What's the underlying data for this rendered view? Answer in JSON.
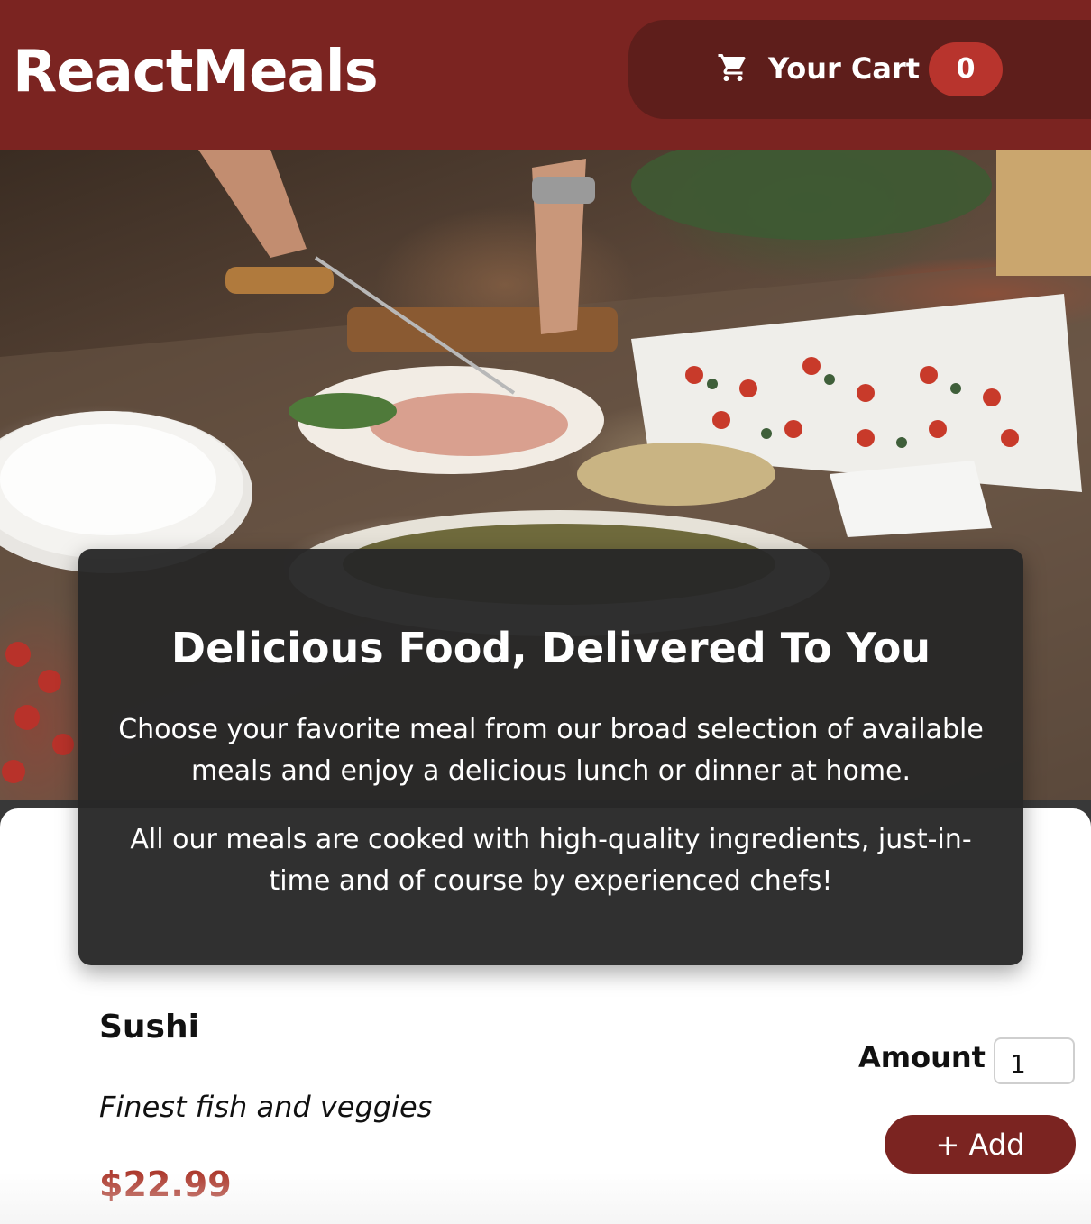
{
  "header": {
    "brand": "ReactMeals",
    "cart": {
      "label": "Your Cart",
      "count": "0",
      "icon": "cart-icon"
    }
  },
  "hero": {
    "image_alt": "A table full of delicious food!"
  },
  "summary": {
    "title": "Delicious Food, Delivered To You",
    "paragraph_1": "Choose your favorite meal from our broad selection of available meals and enjoy a delicious lunch or dinner at home.",
    "paragraph_2": "All our meals are cooked with high-quality ingredients, just-in-time and of course by experienced chefs!"
  },
  "meals": [
    {
      "name": "Sushi",
      "description": "Finest fish and veggies",
      "price": "$22.99",
      "amount_label": "Amount",
      "amount_value": "1",
      "add_label": "+ Add"
    }
  ],
  "colors": {
    "header_bg": "#7b2421",
    "cart_bg": "#5e1e1b",
    "badge_bg": "#b8342d",
    "price": "#ad3a2e",
    "summary_bg": "#282828"
  }
}
